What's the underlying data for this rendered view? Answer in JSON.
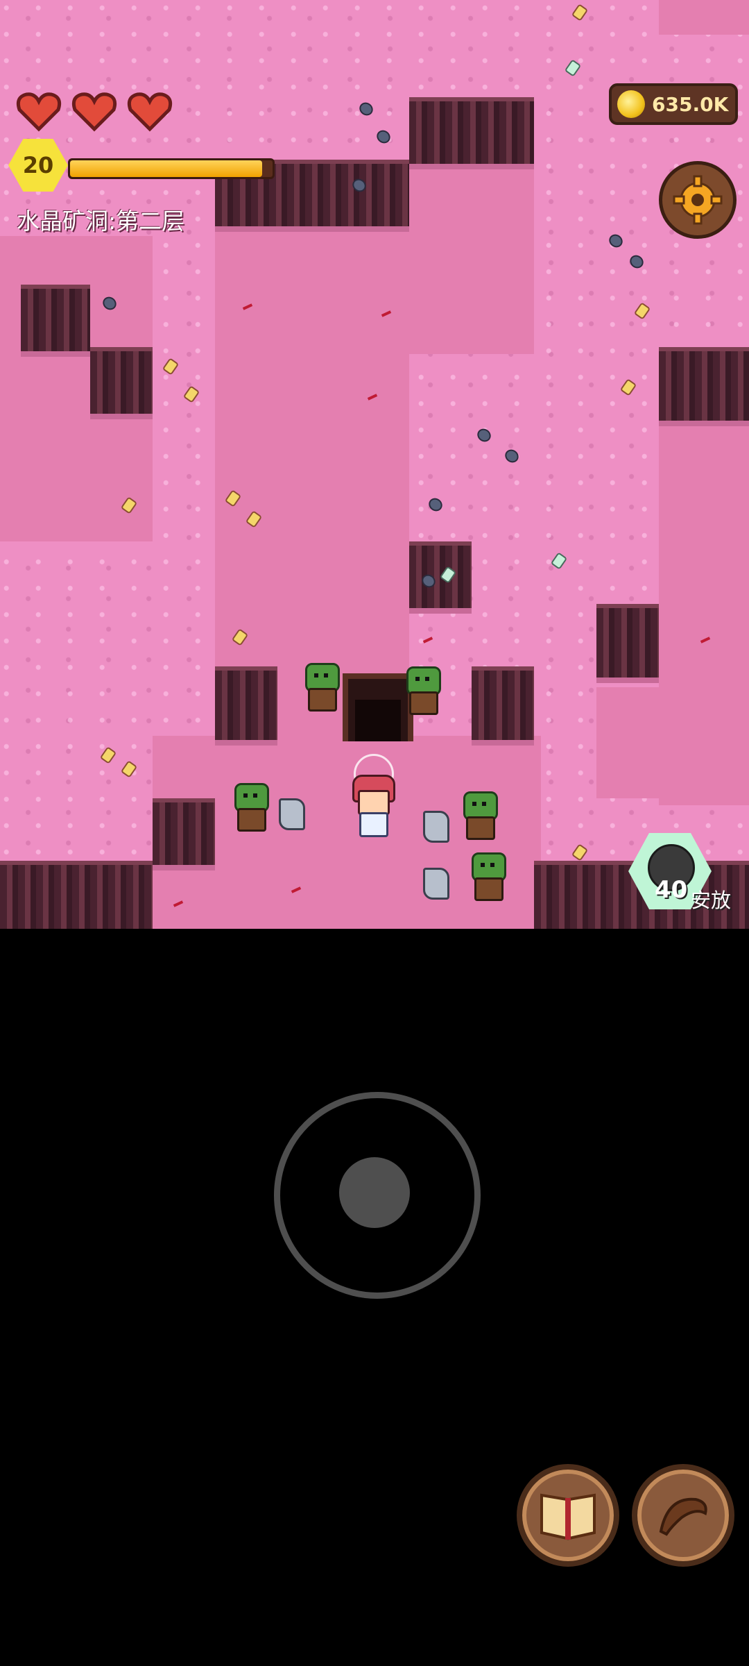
{
  "hud": {
    "hearts": 3,
    "level": "20",
    "xp_fraction": 0.95,
    "floor_name": "水晶矿洞:第二层",
    "coins": "635.0K"
  },
  "bomb": {
    "count": "40",
    "label": "安放"
  },
  "controls": {
    "joystick": "virtual-joystick",
    "book_icon": "spellbook-icon",
    "horn_icon": "horn-icon",
    "settings_icon": "gear-icon"
  },
  "colors": {
    "floor": "#ee8fc4",
    "rock": "#4a2230",
    "xp": "#f1a200",
    "level_badge": "#f6e23b",
    "bomb_button": "#bff5d6"
  }
}
